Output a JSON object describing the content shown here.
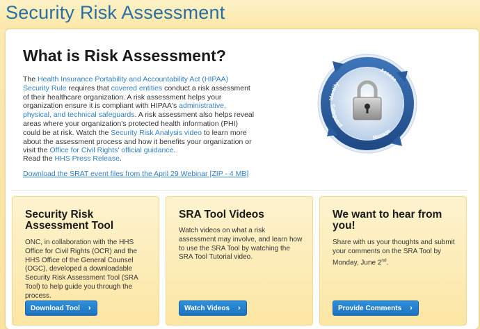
{
  "page": {
    "title": "Security Risk Assessment"
  },
  "intro": {
    "heading": "What is Risk Assessment?",
    "p1": "The ",
    "link_hipaa": "Health Insurance Portability and Accountability Act (HIPAA) Security Rule",
    "p2": " requires that ",
    "link_covered": "covered entities",
    "p3": " conduct a risk assessment of their healthcare organization. A risk assessment helps your organization ensure it is compliant with HIPAA's ",
    "link_safeguards": "administrative, physical, and technical safeguards",
    "p4": ". A risk assessment also helps reveal areas where your organization's protected health information (PHI) could be at risk. Watch the ",
    "link_video": "Security Risk Analysis video",
    "p5": " to learn more about the assessment process and how it benefits your organization or visit the ",
    "link_ocr": "Office for Civil Rights' official guidance",
    "p6": ".",
    "read_prefix": "Read the ",
    "link_press": "HHS Press Release",
    "read_suffix": ".",
    "download_link": "Download the SRAT event files from the April 29 Webinar [ZIP - 4 MB]"
  },
  "graphic": {
    "labels": [
      "Identify",
      "Assess",
      "Manage",
      "Safeguard"
    ],
    "colors": {
      "ring": "#2b5d9e",
      "inner": "#cfdff0",
      "lock": "#9a9a9a"
    }
  },
  "cards": [
    {
      "title": "Security Risk Assessment Tool",
      "text": "ONC, in collaboration with the HHS Office for Civil Rights (OCR) and the HHS Office of the General Counsel (OGC), developed a downloadable Security Risk Assessment Tool (SRA Tool) to help guide you through the process.",
      "button": "Download Tool"
    },
    {
      "title": "SRA Tool Videos",
      "text": "Watch videos on what a risk assessment may involve, and learn how to use the SRA Tool by watching the SRA Tool Tutorial video.",
      "button": "Watch Videos"
    },
    {
      "title": "We want to hear from you!",
      "text_main": "Share with us your thoughts and submit your comments on the SRA Tool by Monday, June 2",
      "text_sup": "nd",
      "text_end": ".",
      "button": "Provide Comments"
    }
  ],
  "colors": {
    "title": "#2a6ea6",
    "link": "#2f7fc1",
    "button": "#2481cc",
    "card_bg": "#fce9ad"
  },
  "icons": {
    "button_chevron": "chevron-right-icon",
    "lock": "lock-icon"
  },
  "chevron_glyph": "›"
}
